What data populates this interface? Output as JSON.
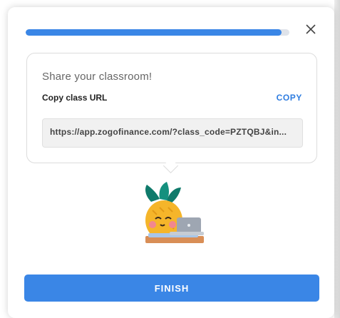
{
  "progress": {
    "fraction": 0.97
  },
  "close": {
    "icon": "close-icon"
  },
  "share": {
    "title": "Share your classroom!",
    "copy_label": "Copy class URL",
    "copy_button": "COPY",
    "url": "https://app.zogofinance.com/?class_code=PZTQBJ&in..."
  },
  "mascot": {
    "icon": "pineapple-laptop-illustration"
  },
  "footer": {
    "finish_label": "FINISH"
  },
  "colors": {
    "accent": "#3a86e6",
    "link": "#2f7de0"
  }
}
